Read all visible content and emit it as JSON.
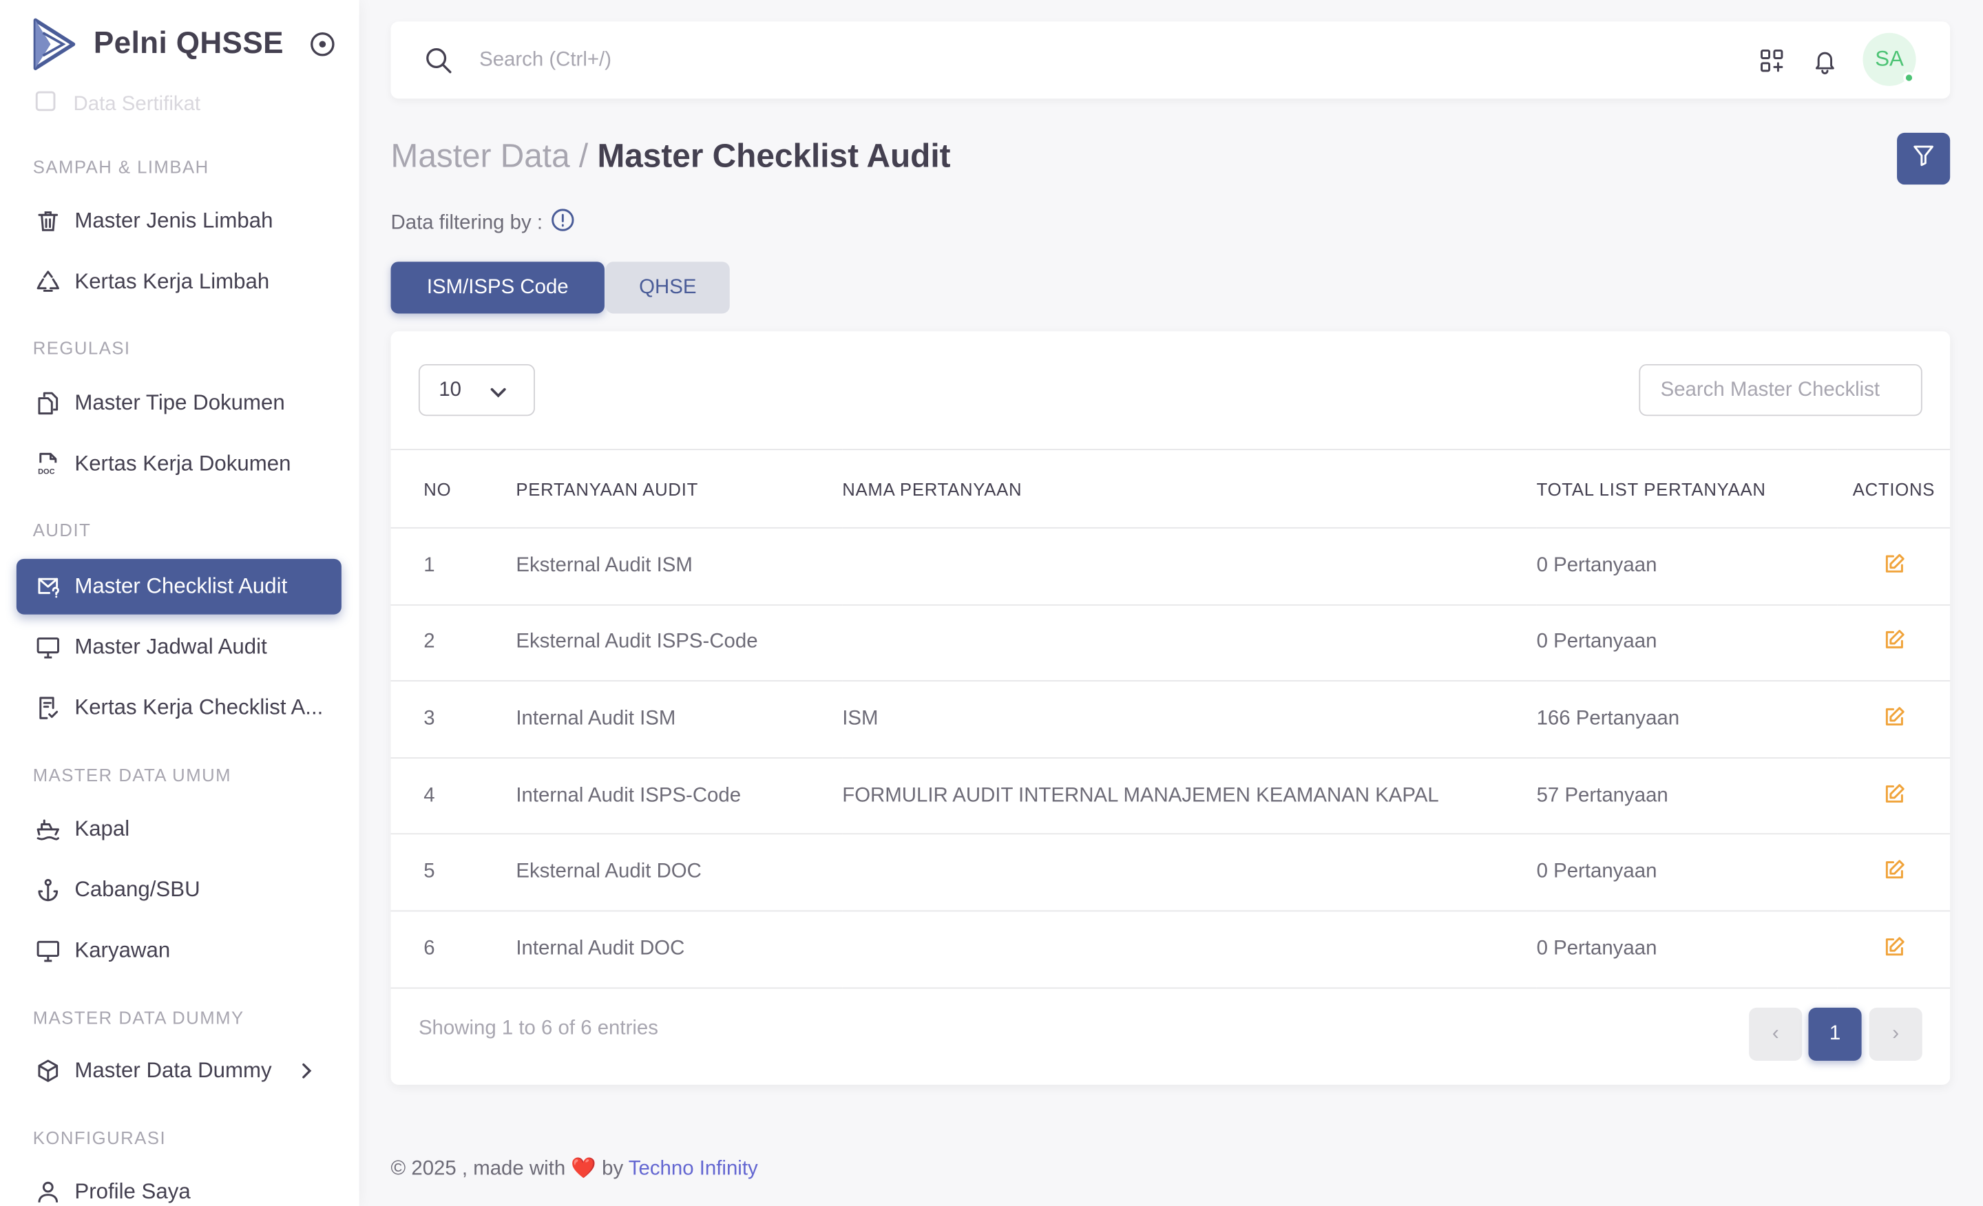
{
  "app": {
    "brand": "Pelni QHSSE"
  },
  "sidebar": {
    "cut_item": "Data Sertifikat",
    "sections": {
      "sampah": "SAMPAH & LIMBAH",
      "regulasi": "REGULASI",
      "audit": "AUDIT",
      "master_umum": "MASTER DATA UMUM",
      "master_dummy": "MASTER DATA DUMMY",
      "konfigurasi": "KONFIGURASI"
    },
    "items": {
      "master_jenis_limbah": "Master Jenis Limbah",
      "kertas_kerja_limbah": "Kertas Kerja Limbah",
      "master_tipe_dokumen": "Master Tipe Dokumen",
      "kertas_kerja_dokumen": "Kertas Kerja Dokumen",
      "master_checklist_audit": "Master Checklist Audit",
      "master_jadwal_audit": "Master Jadwal Audit",
      "kertas_kerja_checklist": "Kertas Kerja Checklist A...",
      "kapal": "Kapal",
      "cabang": "Cabang/SBU",
      "karyawan": "Karyawan",
      "master_data_dummy": "Master Data Dummy",
      "profile_saya": "Profile Saya"
    }
  },
  "topbar": {
    "search_placeholder": "Search (Ctrl+/)",
    "avatar_initials": "SA"
  },
  "page": {
    "crumb": "Master Data /",
    "title": "Master Checklist Audit",
    "filtering_label": "Data filtering by :",
    "tabs": {
      "active": "ISM/ISPS Code",
      "inactive": "QHSE"
    }
  },
  "table": {
    "page_length": "10",
    "search_placeholder": "Search Master Checklist",
    "headers": {
      "no": "NO",
      "pertanyaan_audit": "PERTANYAAN AUDIT",
      "nama_pertanyaan": "NAMA PERTANYAAN",
      "total": "TOTAL LIST PERTANYAAN",
      "actions": "ACTIONS"
    },
    "rows": [
      {
        "no": "1",
        "pertanyaan": "Eksternal Audit ISM",
        "nama": "",
        "total": "0 Pertanyaan"
      },
      {
        "no": "2",
        "pertanyaan": "Eksternal Audit ISPS-Code",
        "nama": "",
        "total": "0 Pertanyaan"
      },
      {
        "no": "3",
        "pertanyaan": "Internal Audit ISM",
        "nama": "ISM",
        "total": "166 Pertanyaan"
      },
      {
        "no": "4",
        "pertanyaan": "Internal Audit ISPS-Code",
        "nama": "FORMULIR AUDIT INTERNAL MANAJEMEN KEAMANAN KAPAL",
        "total": "57 Pertanyaan"
      },
      {
        "no": "5",
        "pertanyaan": "Eksternal Audit DOC",
        "nama": "",
        "total": "0 Pertanyaan"
      },
      {
        "no": "6",
        "pertanyaan": "Internal Audit DOC",
        "nama": "",
        "total": "0 Pertanyaan"
      }
    ],
    "showing": "Showing 1 to 6 of 6 entries",
    "pagination": {
      "prev": "‹",
      "current": "1",
      "next": "›"
    }
  },
  "footer": {
    "prefix": "© 2025 , made with",
    "heart": "❤️",
    "by": "by",
    "link": "Techno Infinity"
  },
  "colors": {
    "primary": "#4a5c98",
    "edit_icon": "#f0a33a",
    "online": "#4cc374",
    "link": "#6366d1"
  }
}
